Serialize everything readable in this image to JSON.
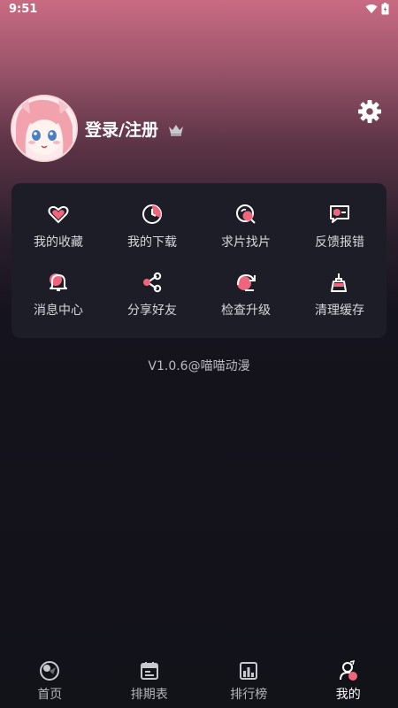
{
  "status_bar": {
    "time": "9:51"
  },
  "profile": {
    "login_label": "登录/注册"
  },
  "menu": {
    "items": [
      {
        "label": "我的收藏",
        "icon": "heart-icon"
      },
      {
        "label": "我的下载",
        "icon": "download-clock-icon"
      },
      {
        "label": "求片找片",
        "icon": "search-film-icon"
      },
      {
        "label": "反馈报错",
        "icon": "feedback-icon"
      },
      {
        "label": "消息中心",
        "icon": "bell-icon"
      },
      {
        "label": "分享好友",
        "icon": "share-icon"
      },
      {
        "label": "检查升级",
        "icon": "upgrade-icon"
      },
      {
        "label": "清理缓存",
        "icon": "broom-icon"
      }
    ]
  },
  "version": "V1.0.6@喵喵动漫",
  "bottom_nav": {
    "items": [
      {
        "label": "首页",
        "icon": "home-icon"
      },
      {
        "label": "排期表",
        "icon": "calendar-icon"
      },
      {
        "label": "排行榜",
        "icon": "ranking-icon"
      },
      {
        "label": "我的",
        "icon": "profile-icon"
      }
    ],
    "active": "我的"
  },
  "colors": {
    "accent": "#f0657b",
    "card_bg": "#1d1d27",
    "page_bg": "#121219"
  }
}
